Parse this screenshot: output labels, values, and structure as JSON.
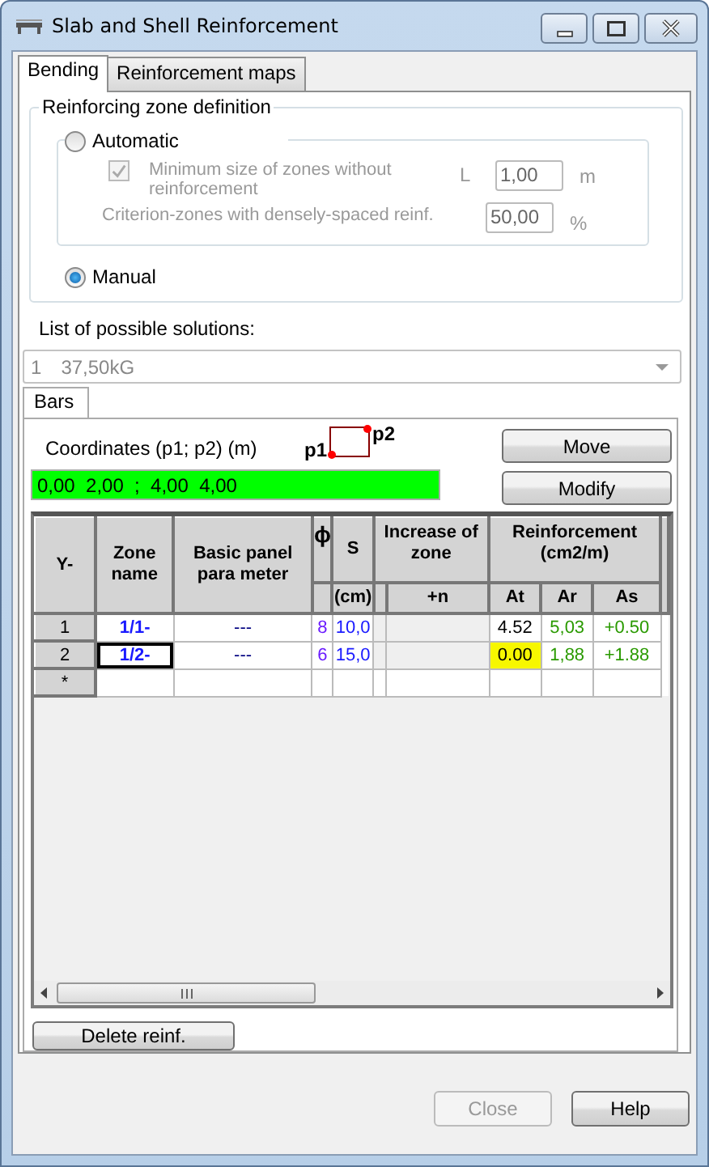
{
  "window": {
    "title": "Slab and Shell Reinforcement"
  },
  "tabs": [
    {
      "label": "Bending",
      "selected": true
    },
    {
      "label": "Reinforcement maps",
      "selected": false
    }
  ],
  "zone_definition": {
    "title": "Reinforcing zone definition",
    "automatic": {
      "label": "Automatic",
      "selected": false
    },
    "options": {
      "disabled": true,
      "min_size": {
        "label": "Minimum size of zones without reinforcement",
        "checked": true,
        "symbol": "L",
        "value": "1,00",
        "unit": "m"
      },
      "criterion": {
        "label": "Criterion-zones with densely-spaced reinf.",
        "value": "50,00",
        "unit": "%"
      }
    },
    "manual": {
      "label": "Manual",
      "selected": true
    }
  },
  "solutions": {
    "label": "List of possible solutions:",
    "disabled": true,
    "number": "1",
    "value": "37,50kG"
  },
  "inner_tabs": [
    {
      "label": "Bars"
    }
  ],
  "bars": {
    "coordinates_label": "Coordinates (p1; p2) (m)",
    "p1": "p1",
    "p2": "p2",
    "coordinates_value": "0,00  2,00  ;  4,00  4,00",
    "buttons": [
      "Move",
      "Modify"
    ],
    "table": {
      "columns": [
        {
          "title": "Y-"
        },
        {
          "title": "Zone name",
          "color": "#1a1aff"
        },
        {
          "title": "Basic panel para meter",
          "color": "#000080"
        },
        {
          "title": "ϕ",
          "color": "#6a1aff"
        },
        {
          "title": "S",
          "unit": "(cm)",
          "color": "#1a1aff"
        },
        {
          "group": "Increase of zone",
          "subs": [
            {
              "disabled": true
            },
            {
              "unit": "+n",
              "disabled": true
            }
          ]
        },
        {
          "group": "Reinforcement (cm2/m)",
          "subs": [
            {
              "unit": "At",
              "color": "#000000"
            },
            {
              "unit": "Ar",
              "color": "#2a9a00"
            },
            {
              "unit": "As",
              "color": "#2a9a00"
            }
          ]
        }
      ],
      "rows": [
        {
          "header": "1",
          "current": false,
          "warning": false,
          "cells": [
            "1/1-",
            "---",
            "8",
            "10,0",
            null,
            null,
            "4.52",
            "5,03",
            "+0.50"
          ]
        },
        {
          "header": "2",
          "current": true,
          "warning": true,
          "cells": [
            "1/2-",
            "---",
            "6",
            "15,0",
            null,
            null,
            "0.00",
            "1,88",
            "+1.88"
          ]
        },
        {
          "header": "*"
        }
      ]
    },
    "delete_button": "Delete reinf."
  },
  "footer": [
    {
      "label": "Close",
      "disabled": true
    },
    {
      "label": "Help",
      "disabled": false
    }
  ]
}
